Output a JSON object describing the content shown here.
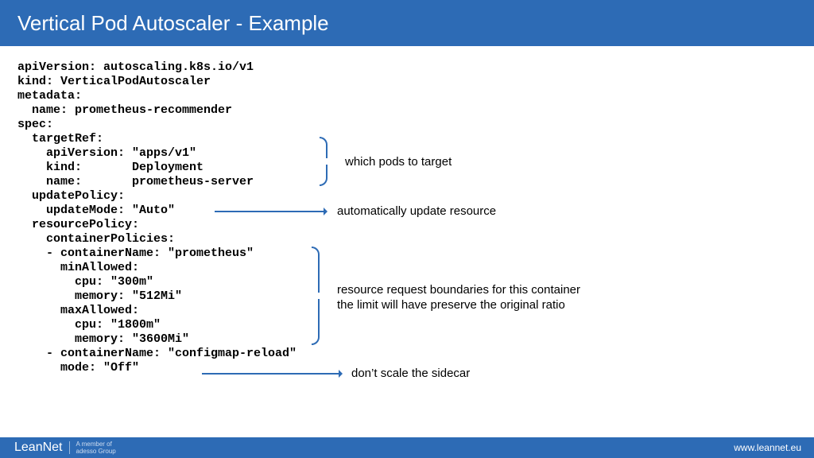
{
  "header": {
    "title": "Vertical Pod Autoscaler - Example"
  },
  "code": "apiVersion: autoscaling.k8s.io/v1\nkind: VerticalPodAutoscaler\nmetadata:\n  name: prometheus-recommender\nspec:\n  targetRef:\n    apiVersion: \"apps/v1\"\n    kind:       Deployment\n    name:       prometheus-server\n  updatePolicy:\n    updateMode: \"Auto\"\n  resourcePolicy:\n    containerPolicies:\n    - containerName: \"prometheus\"\n      minAllowed:\n        cpu: \"300m\"\n        memory: \"512Mi\"\n      maxAllowed:\n        cpu: \"1800m\"\n        memory: \"3600Mi\"\n    - containerName: \"configmap-reload\"\n      mode: \"Off\"",
  "annotations": {
    "target": "which pods to target",
    "update": "automatically update resource",
    "boundaries_l1": "resource request boundaries for this container",
    "boundaries_l2": "the limit will have preserve the original ratio",
    "sidecar": "don’t scale the sidecar"
  },
  "footer": {
    "brand": "LeanNet",
    "member_l1": "A member of",
    "member_l2": "adesso Group",
    "url": "www.leannet.eu"
  },
  "colors": {
    "accent": "#2d6bb5"
  }
}
